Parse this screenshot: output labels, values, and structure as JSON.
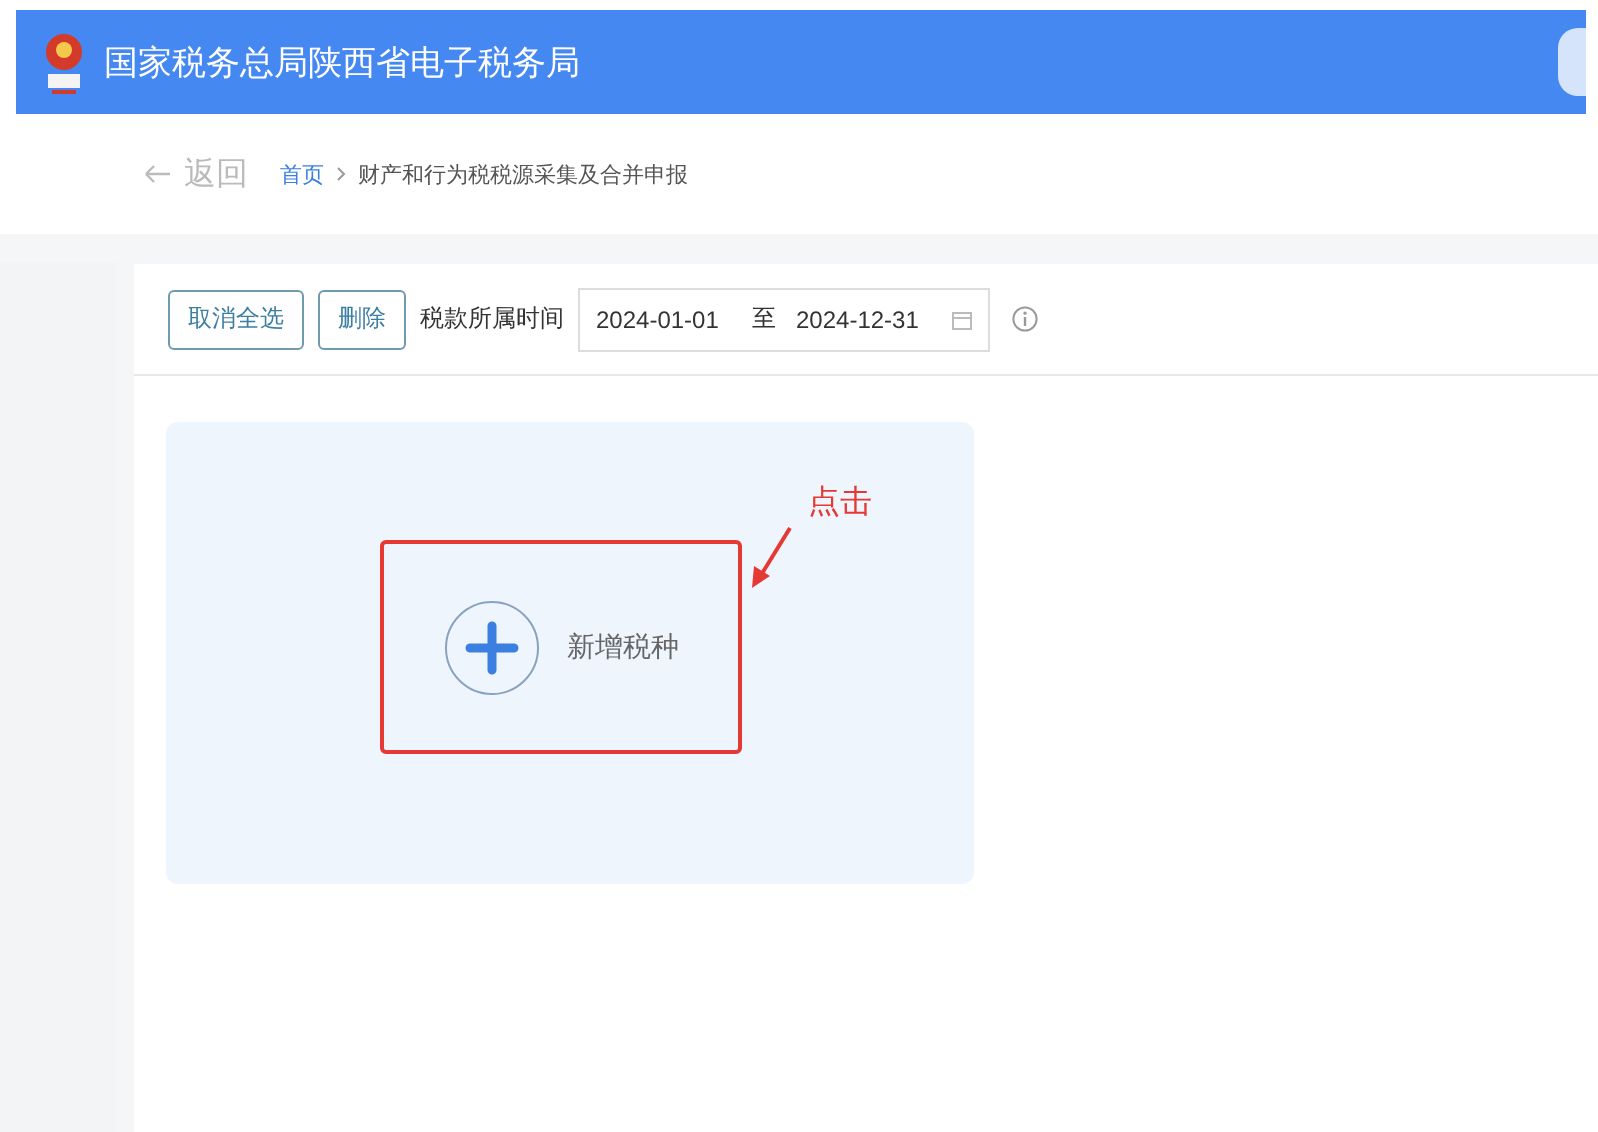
{
  "header": {
    "title": "国家税务总局陕西省电子税务局"
  },
  "breadcrumb": {
    "back": "返回",
    "items": [
      "首页",
      "财产和行为税税源采集及合并申报"
    ]
  },
  "toolbar": {
    "buttons": [
      "取消全选",
      "删除"
    ],
    "date_label": "税款所属时间",
    "start_date": "2024-01-01",
    "separator": "至",
    "end_date": "2024-12-31"
  },
  "add_card": {
    "label": "新增税种"
  },
  "annotation": {
    "text": "点击"
  }
}
